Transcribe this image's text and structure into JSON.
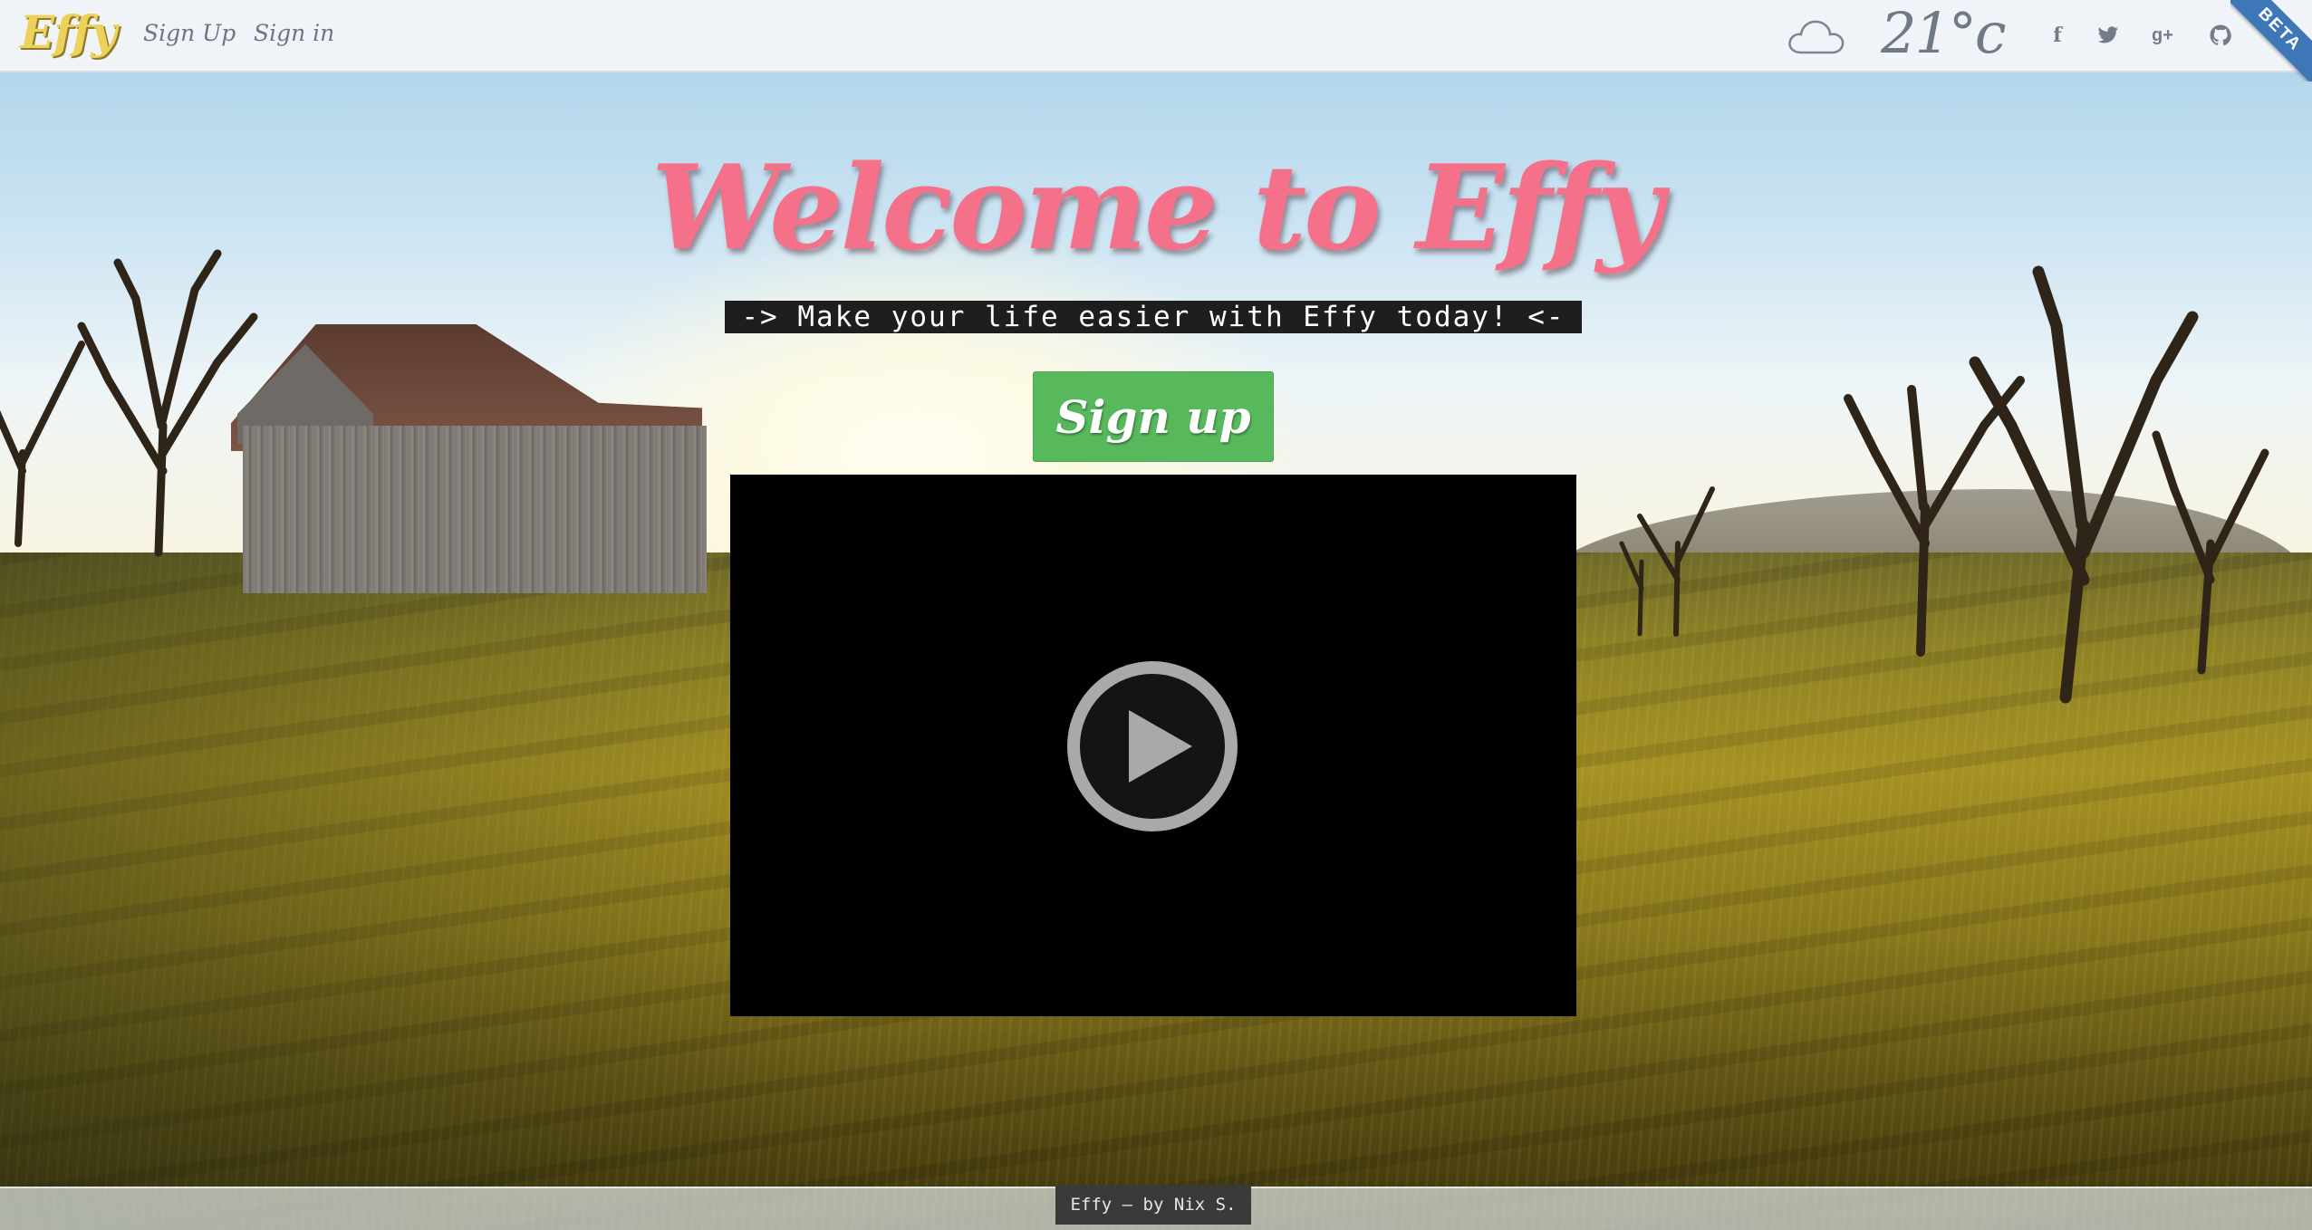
{
  "header": {
    "logo": "Effy",
    "nav": [
      {
        "label": "Sign Up"
      },
      {
        "label": "Sign in"
      }
    ],
    "weather": {
      "icon": "cloud-icon",
      "temperature": "21°c"
    },
    "social": [
      {
        "icon": "facebook-icon",
        "glyph": "f"
      },
      {
        "icon": "twitter-icon",
        "glyph": "🐦"
      },
      {
        "icon": "google-plus-icon",
        "glyph": "g+"
      },
      {
        "icon": "github-icon",
        "glyph": "⌾"
      }
    ],
    "ribbon": "BETA"
  },
  "hero": {
    "title": "Welcome to Effy",
    "tagline": "-> Make your life easier with Effy today! <-",
    "cta_label": "Sign up",
    "video": {
      "play_icon": "play-icon"
    }
  },
  "footer": {
    "credit": "Effy – by Nix S."
  },
  "colors": {
    "title_pink": "#f5718a",
    "logo_yellow": "#ecd25a",
    "cta_green": "#58b85c",
    "ribbon_blue": "#3d77b7"
  }
}
